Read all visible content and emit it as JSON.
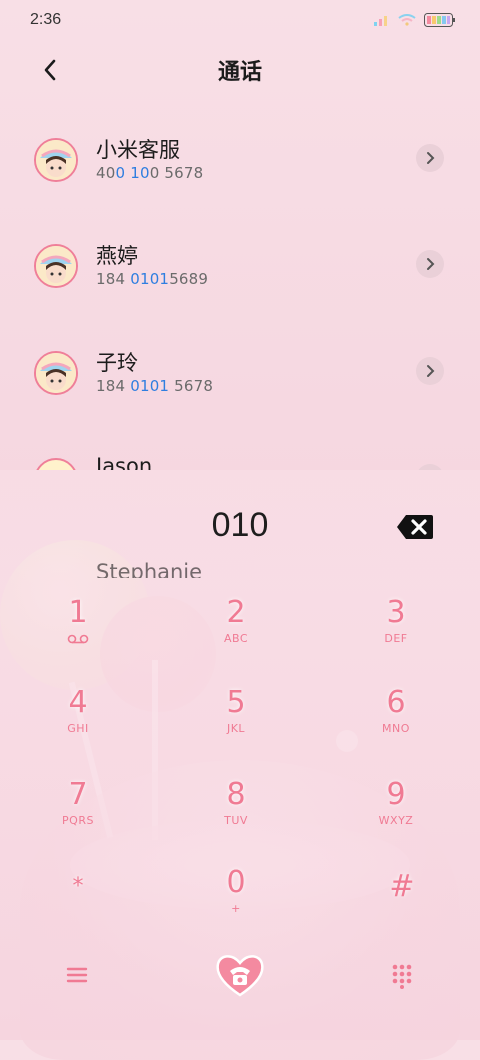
{
  "status_bar": {
    "time": "2:36"
  },
  "header": {
    "title": "通话"
  },
  "contacts": [
    {
      "name": "小米客服",
      "number_parts": [
        "40",
        "0 10",
        "0 5678"
      ]
    },
    {
      "name": "燕婷",
      "number_parts": [
        "184 ",
        "0101",
        "5689"
      ]
    },
    {
      "name": "子玲",
      "number_parts": [
        "184 ",
        "0101",
        " 5678"
      ]
    },
    {
      "name": "Jason",
      "number_parts": [
        "",
        "",
        ""
      ]
    },
    {
      "name": "Stephanie",
      "number_parts": [
        "",
        "",
        ""
      ]
    }
  ],
  "dialer": {
    "input_value": "010",
    "keys": [
      {
        "digit": "1",
        "letters": ""
      },
      {
        "digit": "2",
        "letters": "ABC"
      },
      {
        "digit": "3",
        "letters": "DEF"
      },
      {
        "digit": "4",
        "letters": "GHI"
      },
      {
        "digit": "5",
        "letters": "JKL"
      },
      {
        "digit": "6",
        "letters": "MNO"
      },
      {
        "digit": "7",
        "letters": "PQRS"
      },
      {
        "digit": "8",
        "letters": "TUV"
      },
      {
        "digit": "9",
        "letters": "WXYZ"
      },
      {
        "digit": "*",
        "letters": ""
      },
      {
        "digit": "0",
        "letters": "+"
      },
      {
        "digit": "#",
        "letters": ""
      }
    ]
  },
  "icons": {
    "back": "back-arrow-icon",
    "detail": "chevron-right-icon",
    "backspace": "backspace-icon",
    "menu": "menu-icon",
    "call": "phone-heart-icon",
    "keypad": "keypad-icon",
    "voicemail": "voicemail-icon"
  },
  "colors": {
    "accent": "#f07a93",
    "highlight": "#2f7ee0",
    "background": "#f6d8e1"
  }
}
